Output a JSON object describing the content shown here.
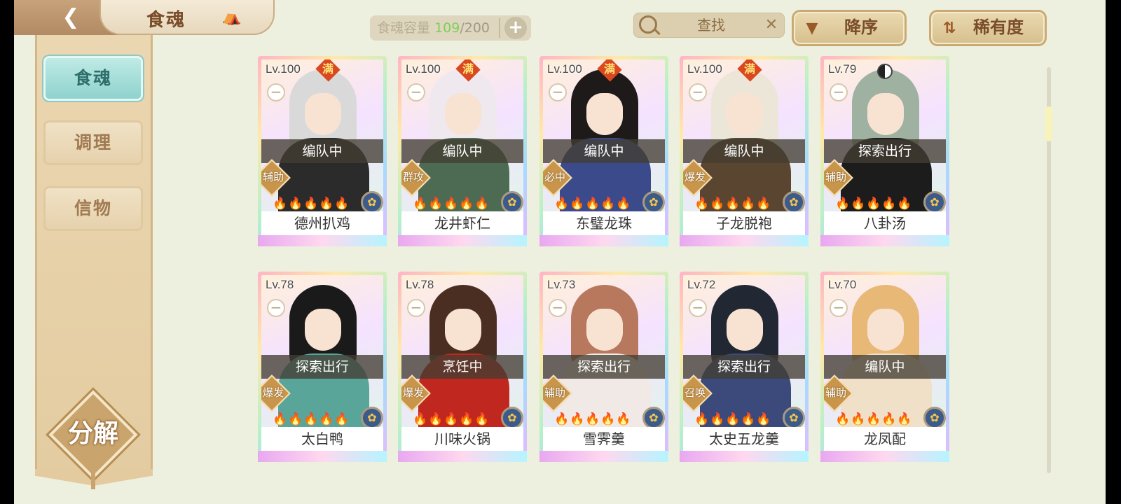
{
  "header": {
    "title": "食魂",
    "back_icon": "back-arrow-icon",
    "home_icon": "pavilion-icon",
    "capacity_label": "食魂容量",
    "capacity_current": "109",
    "capacity_separator": "/",
    "capacity_max": "200",
    "capacity_add": "+",
    "search_placeholder": "查找",
    "search_clear": "✕",
    "sort_order_label": "降序",
    "sort_order_icon": "▼",
    "sort_key_label": "稀有度",
    "sort_key_icon": "⇅"
  },
  "sidebar": {
    "items": [
      {
        "label": "食魂",
        "active": true
      },
      {
        "label": "调理",
        "active": false
      },
      {
        "label": "信物",
        "active": false
      }
    ],
    "decompose_label": "分解"
  },
  "cards": [
    {
      "level": "Lv.100",
      "max": "满",
      "status": "编队中",
      "role": "辅助",
      "name": "德州扒鸡",
      "stars_on": 5,
      "hair": "#d9d9d9",
      "outfit": "#2b2b2b"
    },
    {
      "level": "Lv.100",
      "max": "满",
      "status": "编队中",
      "role": "群攻",
      "name": "龙井虾仁",
      "stars_on": 5,
      "hair": "#efe8ee",
      "outfit": "#4d6a52"
    },
    {
      "level": "Lv.100",
      "max": "满",
      "status": "编队中",
      "role": "必中",
      "name": "东璧龙珠",
      "stars_on": 5,
      "hair": "#1f1a1a",
      "outfit": "#3a4a8a"
    },
    {
      "level": "Lv.100",
      "max": "满",
      "status": "编队中",
      "role": "爆发",
      "name": "子龙脱袍",
      "stars_on": 5,
      "hair": "#ece6d8",
      "outfit": "#5a4630"
    },
    {
      "level": "Lv.79",
      "max": "",
      "status": "探索出行",
      "role": "辅助",
      "name": "八卦汤",
      "stars_on": 4,
      "hair": "#9fb1a0",
      "outfit": "#1c1c1c"
    },
    {
      "level": "Lv.78",
      "max": "",
      "status": "探索出行",
      "role": "爆发",
      "name": "太白鸭",
      "stars_on": 4,
      "hair": "#1a1a1a",
      "outfit": "#5aa59a"
    },
    {
      "level": "Lv.78",
      "max": "",
      "status": "烹饪中",
      "role": "爆发",
      "name": "川味火锅",
      "stars_on": 4,
      "hair": "#4a2e22",
      "outfit": "#c0271e"
    },
    {
      "level": "Lv.73",
      "max": "",
      "status": "探索出行",
      "role": "辅助",
      "name": "雪霁羹",
      "stars_on": 5,
      "hair": "#b8785e",
      "outfit": "#f1e9e6"
    },
    {
      "level": "Lv.72",
      "max": "",
      "status": "探索出行",
      "role": "召唤",
      "name": "太史五龙羹",
      "stars_on": 4,
      "hair": "#222833",
      "outfit": "#3b4a7a"
    },
    {
      "level": "Lv.70",
      "max": "",
      "status": "编队中",
      "role": "辅助",
      "name": "龙凤配",
      "stars_on": 4,
      "hair": "#e8b877",
      "outfit": "#f0e0c8"
    }
  ],
  "icons": {
    "flame": "flame-icon",
    "element": "element-orb-icon",
    "minus": "minus-icon",
    "yin_yang": "yin-yang-icon"
  }
}
